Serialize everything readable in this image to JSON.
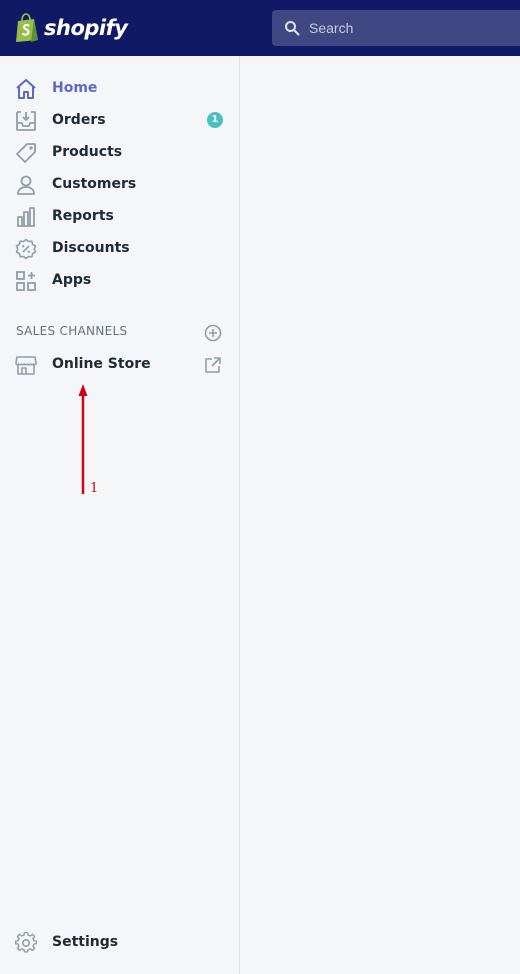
{
  "topbar": {
    "brand": "shopify",
    "search_placeholder": "Search",
    "bg_color": "#0f1965"
  },
  "sidebar": {
    "items": [
      {
        "label": "Home",
        "icon": "home-icon",
        "active": true
      },
      {
        "label": "Orders",
        "icon": "orders-icon",
        "badge": "1"
      },
      {
        "label": "Products",
        "icon": "tag-icon"
      },
      {
        "label": "Customers",
        "icon": "person-icon"
      },
      {
        "label": "Reports",
        "icon": "bar-chart-icon"
      },
      {
        "label": "Discounts",
        "icon": "discount-icon"
      },
      {
        "label": "Apps",
        "icon": "apps-icon"
      }
    ],
    "sales_channels_title": "SALES CHANNELS",
    "channels": [
      {
        "label": "Online Store",
        "icon": "store-icon"
      }
    ],
    "settings_label": "Settings",
    "accent_color": "#5c6ac4",
    "badge_color": "#47c1bf"
  },
  "annotation": {
    "label": "1",
    "color": "#d0021b"
  }
}
